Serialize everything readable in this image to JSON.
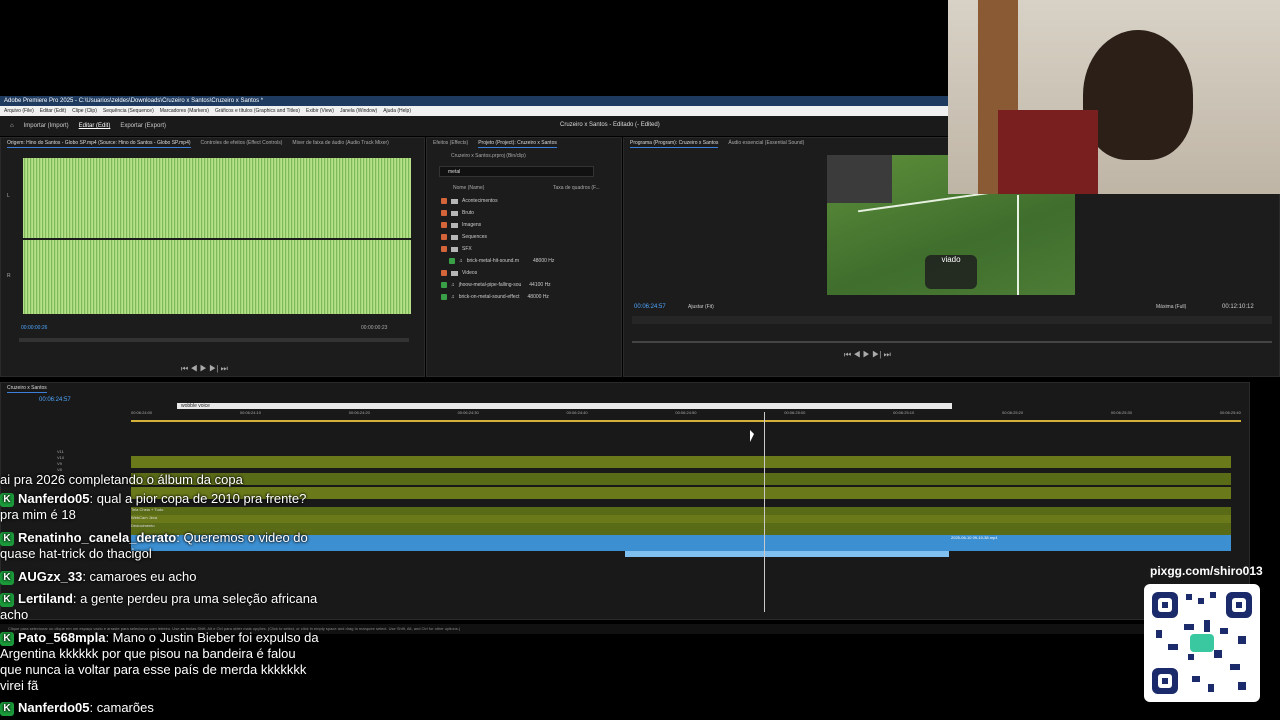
{
  "app": {
    "title": "Adobe Premiere Pro 2025 - C:\\Usuarios\\zeldes\\Downloads\\Cruzeiro x Santos\\Cruzeiro x Santos *",
    "menu": [
      "Arquivo (File)",
      "Editar (Edit)",
      "Clipe (Clip)",
      "Sequência (Sequence)",
      "Marcadores (Markers)",
      "Gráficos e títulos (Graphics and Titles)",
      "Exibir (View)",
      "Janela (Window)",
      "Ajuda (Help)"
    ],
    "workspace_tabs": [
      "Importar (Import)",
      "Editar (Edit)",
      "Exportar (Export)"
    ],
    "active_workspace": "Editar (Edit)",
    "project_title": "Cruzeiro x Santos - Editado (- Edited)"
  },
  "source_panel": {
    "tabs": [
      "Origem: Hino do Santos - Globo SP.mp4 (Source: Hino do Santos - Globo SP.mp4)",
      "Controles de efeitos (Effect Controls)",
      "Mixer de faixa de áudio (Audio Track Mixer)"
    ],
    "channel_labels": [
      "L",
      "R"
    ],
    "timecode_in": "00:00:00:26",
    "timecode_duration": "00:00:00:23"
  },
  "project_panel": {
    "tabs": [
      "Efeitos (Effects)",
      "Projeto (Project): Cruzeiro x Santos"
    ],
    "path": "Cruzeiro x Santos.prproj (Bin/clip)",
    "search_value": "metal",
    "columns": [
      "Nome (Name)",
      "Taxa de quadros (F..."
    ],
    "items": [
      {
        "name": "Acontecimentos",
        "type": "folder",
        "color": "#d4643a",
        "rate": ""
      },
      {
        "name": "Bruto",
        "type": "folder",
        "color": "#d4643a",
        "rate": ""
      },
      {
        "name": "Imagens",
        "type": "folder",
        "color": "#d4643a",
        "rate": ""
      },
      {
        "name": "Sequences",
        "type": "folder",
        "color": "#d4643a",
        "rate": ""
      },
      {
        "name": "SFX",
        "type": "folder",
        "color": "#d4643a",
        "rate": ""
      },
      {
        "name": "brick-metal-hit-sound.m",
        "type": "audio",
        "color": "#3aa048",
        "rate": "48000 Hz"
      },
      {
        "name": "Videos",
        "type": "folder",
        "color": "#d4643a",
        "rate": ""
      },
      {
        "name": "jhoow-metal-pipe-falling-sou",
        "type": "audio",
        "color": "#3aa048",
        "rate": "44100 Hz"
      },
      {
        "name": "brick-on-metal-sound-effect",
        "type": "audio",
        "color": "#3aa048",
        "rate": "48000 Hz"
      }
    ]
  },
  "program_panel": {
    "tabs": [
      "Programa (Program): Cruzeiro x Santos",
      "Áudio essencial (Essential Sound)"
    ],
    "timecode": "00:06:24:57",
    "fit_label": "Ajustar (Fit)",
    "quality_label": "Máxima (Full)",
    "duration": "00:12:10:12",
    "overlay_caption": "viado"
  },
  "timeline": {
    "sequence_tab": "Cruzeiro x Santos",
    "current_timecode": "00:06:24:57",
    "tooltip": "wobble voice",
    "ruler_ticks": [
      "00:06:24:00",
      "00:06:24:05",
      "00:06:24:10",
      "00:06:24:15",
      "00:06:24:20",
      "00:06:24:25",
      "00:06:24:30",
      "00:06:24:35",
      "00:06:24:40",
      "00:06:24:45",
      "00:06:24:50",
      "00:06:24:55",
      "00:06:25:00",
      "00:06:25:05",
      "00:06:25:10",
      "00:06:25:15",
      "00:06:25:20",
      "00:06:25:25",
      "00:06:25:30",
      "00:06:25:35",
      "00:06:25:40"
    ],
    "track_labels": [
      "V11",
      "V10",
      "V9",
      "V8"
    ],
    "clip_labels": [
      "Tela Cheia + Tudo",
      "WebCam Jeca",
      "Dedocimento",
      "2025-06-10 09-10-38.mp4"
    ],
    "status_text": "Clique para selecionar ou clique em um espaço vazio e arraste para selecionar com letreiro. Use as teclas Shift, Alt e Ctrl para obter mais opções. (Click to select, or click in empty space and drag to marquee select. Use Shift, Alt, and Ctrl for other options.)"
  },
  "chat": {
    "partial_top": "ai pra 2026 completando o álbum da copa",
    "messages": [
      {
        "user": "Nanferdo05",
        "text": "qual a pior copa de 2010 pra frente? pra mim é 18"
      },
      {
        "user": "Renatinho_canela_derato",
        "text": "Queremos o video do quase hat-trick do thacigol"
      },
      {
        "user": "AUGzx_33",
        "text": "camaroes eu acho"
      },
      {
        "user": "Lertiland",
        "text": "a gente perdeu pra uma seleção africana acho"
      },
      {
        "user": "Pato_568mpla",
        "text": "Mano o Justin Bieber foi expulso da Argentina kkkkkk por que pisou na bandeira é falou que nunca ia voltar para esse país de merda kkkkkkk virei fã"
      },
      {
        "user": "Nanferdo05",
        "text": "camarões"
      }
    ]
  },
  "overlay": {
    "qr_url": "pixgg.com/shiro013"
  }
}
